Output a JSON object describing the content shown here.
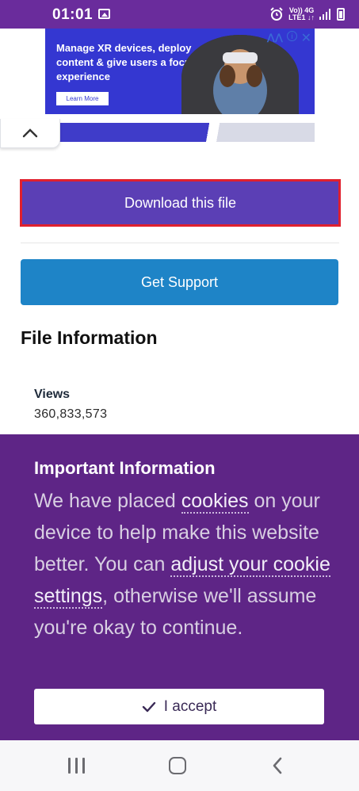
{
  "status_bar": {
    "time": "01:01",
    "network_line1": "Vo)) 4G",
    "network_line2": "LTE1 ↓↑",
    "icons": [
      "gallery-icon",
      "alarm-icon",
      "signal-icon",
      "battery-icon"
    ]
  },
  "ad": {
    "headline": "Manage XR devices, deploy content & give users a focused experience",
    "cta": "Learn More",
    "close_glyph": "✕",
    "info_glyph": "i",
    "logo_glyph": "⋀⋀"
  },
  "main": {
    "download_label": "Download this file",
    "support_label": "Get Support",
    "file_info_title": "File Information",
    "views_label": "Views",
    "views_value": "360,833,573"
  },
  "cookie_banner": {
    "title": "Important Information",
    "text_1": "We have placed ",
    "link_cookies": "cookies",
    "text_2": " on your device to help make this website better. You can ",
    "link_settings": "adjust your cookie settings",
    "text_3": ", otherwise we'll assume you're okay to continue.",
    "accept_label": "I accept"
  },
  "colors": {
    "status_bar": "#6a2c9c",
    "download_button": "#5b3fb5",
    "download_outline": "#e0202e",
    "support_button": "#1e84c7",
    "cookie_background": "#5e2586"
  }
}
